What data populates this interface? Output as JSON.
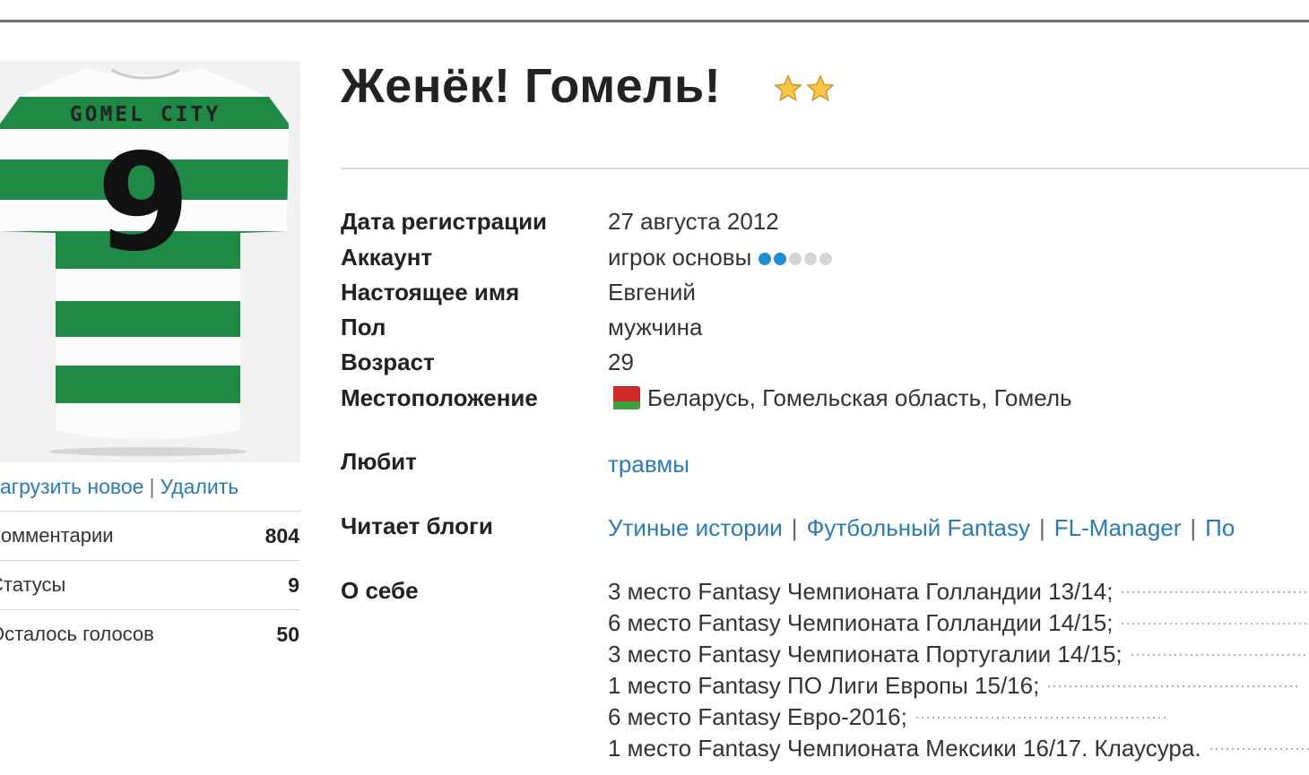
{
  "profile": {
    "title": "Женёк! Гомель!",
    "stars": 2,
    "avatar": {
      "shirt_text": "GOMEL CITY",
      "shirt_number": "9",
      "upload_label": "Загрузить новое",
      "delete_label": "Удалить"
    },
    "stats": [
      {
        "label": "Комментарии",
        "value": "804"
      },
      {
        "label": "Статусы",
        "value": "9"
      },
      {
        "label": "Осталось голосов",
        "value": "50"
      }
    ],
    "fields": {
      "registration": {
        "label": "Дата регистрации",
        "value": "27 августа 2012"
      },
      "account": {
        "label": "Аккаунт",
        "value": "игрок основы",
        "level": 2,
        "level_max": 5
      },
      "real_name": {
        "label": "Настоящее имя",
        "value": "Евгений"
      },
      "gender": {
        "label": "Пол",
        "value": "мужчина"
      },
      "age": {
        "label": "Возраст",
        "value": "29"
      },
      "location": {
        "label": "Местоположение",
        "value": "Беларусь, Гомельская область, Гомель"
      },
      "likes": {
        "label": "Любит",
        "value": "травмы"
      },
      "blogs": {
        "label": "Читает блоги",
        "items": [
          "Утиные истории",
          "Футбольный Fantasy",
          "FL-Manager",
          "По"
        ]
      },
      "about": {
        "label": "О себе",
        "lines": [
          "3 место Fantasy Чемпионата Голландии 13/14;",
          "6 место Fantasy Чемпионата Голландии 14/15;",
          "3 место Fantasy Чемпионата Португалии 14/15;",
          "1 место Fantasy ПО Лиги Европы 15/16;",
          "6 место Fantasy Евро-2016;",
          "1 место Fantasy Чемпионата Мексики 16/17. Клаусура."
        ]
      }
    }
  },
  "colors": {
    "link": "#2a7ab5",
    "shirt_green": "#1f8a45",
    "level_on": "#1e8fd6",
    "level_off": "#d4d4d4"
  }
}
